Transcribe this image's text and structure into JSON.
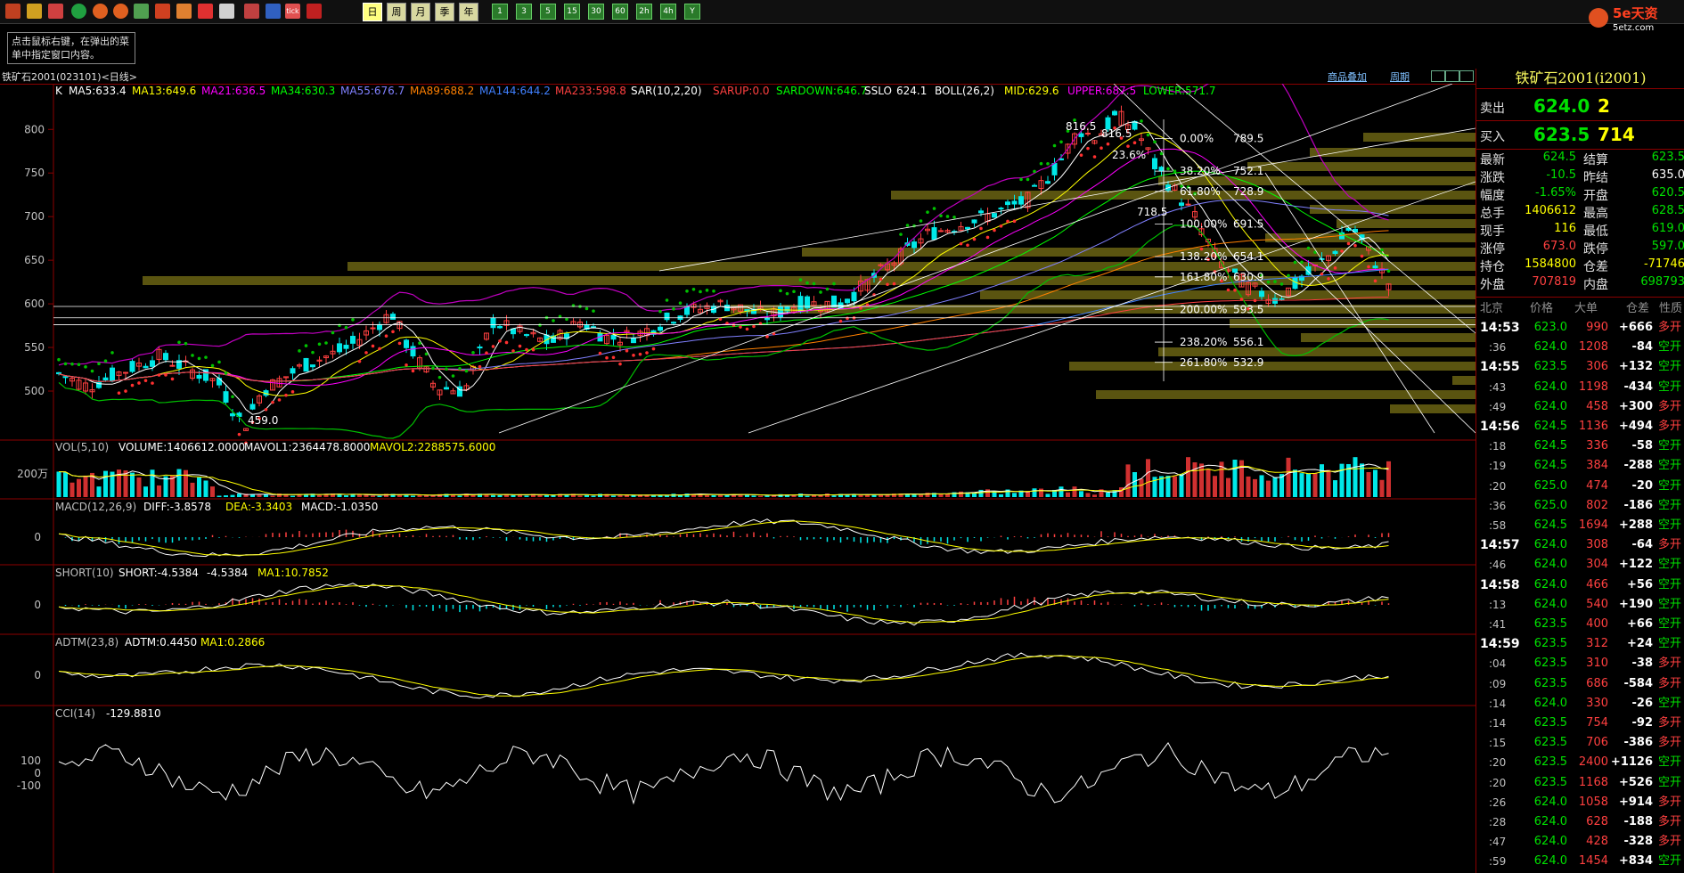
{
  "toolbar": {
    "icons": [
      "home-icon",
      "folder-icon",
      "window-icon",
      "refresh-icon",
      "zoom-in-icon",
      "zoom-out-icon",
      "tile-icon",
      "pen-icon",
      "brush-icon",
      "filter-icon",
      "new-icon",
      "table-icon",
      "tick-icon",
      "cross-icon"
    ],
    "tick_label": "tick",
    "periods": [
      "日",
      "周",
      "月",
      "季",
      "年"
    ],
    "active_period": "日",
    "intervals": [
      "1",
      "3",
      "5",
      "15",
      "30",
      "60",
      "2h",
      "4h",
      "Y"
    ]
  },
  "brand": {
    "name": "5e天资",
    "site": "5etz.com"
  },
  "tip": "点击鼠标右键，在弹出的菜单中指定窗口内容。",
  "window_title": "铁矿石2001(023101)<日线>",
  "title_links": [
    "商品叠加",
    "周期"
  ],
  "legend": {
    "main": [
      {
        "t": "K",
        "c": "#ffffff"
      },
      {
        "t": "MA5:633.4",
        "c": "#ffffff"
      },
      {
        "t": "MA13:649.6",
        "c": "#ffff00"
      },
      {
        "t": "MA21:636.5",
        "c": "#ff00ff"
      },
      {
        "t": "MA34:630.3",
        "c": "#00ff00"
      },
      {
        "t": "MA55:676.7",
        "c": "#8080ff"
      },
      {
        "t": "MA89:688.2",
        "c": "#ff8000"
      },
      {
        "t": "MA144:644.2",
        "c": "#4080ff"
      },
      {
        "t": "MA233:598.8",
        "c": "#ff4040"
      },
      {
        "t": "SAR(10,2,20)",
        "c": "#ffffff"
      },
      {
        "t": "SARUP:0.0",
        "c": "#ff4040"
      },
      {
        "t": "SARDOWN:646.7",
        "c": "#00ff00"
      },
      {
        "t": "SSLO",
        "c": "#ffffff"
      },
      {
        "t": "624.1",
        "c": "#ffffff"
      },
      {
        "t": "BOLL(26,2)",
        "c": "#ffffff"
      },
      {
        "t": "MID:629.6",
        "c": "#ffff00"
      },
      {
        "t": "UPPER:687.5",
        "c": "#ff00ff"
      },
      {
        "t": "LOWER:571.7",
        "c": "#00ff00"
      }
    ],
    "vol": [
      {
        "t": "VOL(5,10)",
        "c": "#c0c0c0"
      },
      {
        "t": "VOLUME:1406612.0000",
        "c": "#ffffff"
      },
      {
        "t": "MAVOL1:2364478.8000",
        "c": "#ffffff"
      },
      {
        "t": "MAVOL2:2288575.6000",
        "c": "#ffff00"
      }
    ],
    "macd": [
      {
        "t": "MACD(12,26,9)",
        "c": "#c0c0c0"
      },
      {
        "t": "DIFF:-3.8578",
        "c": "#ffffff"
      },
      {
        "t": "DEA:-3.3403",
        "c": "#ffff00"
      },
      {
        "t": "MACD:-1.0350",
        "c": "#ffffff"
      }
    ],
    "short": [
      {
        "t": "SHORT(10)",
        "c": "#c0c0c0"
      },
      {
        "t": "SHORT:-4.5384",
        "c": "#ffffff"
      },
      {
        "t": "-4.5384",
        "c": "#ffffff"
      },
      {
        "t": "MA1:10.7852",
        "c": "#ffff00"
      }
    ],
    "adtm": [
      {
        "t": "ADTM(23,8)",
        "c": "#c0c0c0"
      },
      {
        "t": "ADTM:0.4450",
        "c": "#ffffff"
      },
      {
        "t": "MA1:0.2866",
        "c": "#ffff00"
      }
    ],
    "cci": [
      {
        "t": "CCI(14)",
        "c": "#c0c0c0"
      },
      {
        "t": "-129.8810",
        "c": "#ffffff"
      }
    ]
  },
  "chart_data": {
    "type": "candlestick",
    "price_axis": {
      "ticks": [
        800,
        750,
        700,
        650,
        600,
        550,
        500
      ],
      "range": [
        452,
        836
      ]
    },
    "vol_axis_label": "200万",
    "macd_axis_label": "0",
    "short_axis_label": "0",
    "adtm_axis_label": "0",
    "cci_axis_labels": [
      "100",
      "0",
      "-100"
    ],
    "annotations": {
      "high": "816.5",
      "low": "459.0",
      "high2": "816.5",
      "low2": "718.5"
    },
    "fib_levels": [
      {
        "pct": "0.00%",
        "val": "789.5"
      },
      {
        "pct": "38.20%",
        "val": "752.1"
      },
      {
        "pct": "61.80%",
        "val": "728.9"
      },
      {
        "pct": "100.00%",
        "val": "691.5"
      },
      {
        "pct": "138.20%",
        "val": "654.1"
      },
      {
        "pct": "161.80%",
        "val": "630.9"
      },
      {
        "pct": "200.00%",
        "val": "593.5"
      },
      {
        "pct": "238.20%",
        "val": "556.1"
      },
      {
        "pct": "261.80%",
        "val": "532.9"
      }
    ],
    "fib_partial": [
      "23.6%",
      "0.00%"
    ],
    "last_close": 624.5
  },
  "quote": {
    "symbol_title": "铁矿石2001(i2001)",
    "sell": {
      "label": "卖出",
      "price": "624.0",
      "qty": "2"
    },
    "buy": {
      "label": "买入",
      "price": "623.5",
      "qty": "714"
    },
    "rows": [
      [
        {
          "l": "最新",
          "v": "624.5",
          "c": "dn"
        },
        {
          "l": "结算",
          "v": "623.5",
          "c": "dn"
        }
      ],
      [
        {
          "l": "涨跌",
          "v": "-10.5",
          "c": "dn"
        },
        {
          "l": "昨结",
          "v": "635.0",
          "c": "wt"
        }
      ],
      [
        {
          "l": "幅度",
          "v": "-1.65%",
          "c": "dn"
        },
        {
          "l": "开盘",
          "v": "620.5",
          "c": "dn"
        }
      ],
      [
        {
          "l": "总手",
          "v": "1406612",
          "c": "yl"
        },
        {
          "l": "最高",
          "v": "628.5",
          "c": "dn"
        }
      ],
      [
        {
          "l": "现手",
          "v": "116",
          "c": "yl"
        },
        {
          "l": "最低",
          "v": "619.0",
          "c": "dn"
        }
      ],
      [
        {
          "l": "涨停",
          "v": "673.0",
          "c": "up"
        },
        {
          "l": "跌停",
          "v": "597.0",
          "c": "dn"
        }
      ],
      [
        {
          "l": "持仓",
          "v": "1584800",
          "c": "yl"
        },
        {
          "l": "仓差",
          "v": "-71746",
          "c": "yl"
        }
      ],
      [
        {
          "l": "外盘",
          "v": "707819",
          "c": "up"
        },
        {
          "l": "内盘",
          "v": "698793",
          "c": "dn"
        }
      ]
    ],
    "tick_header": [
      "北京",
      "价格",
      "大单",
      "仓差",
      "性质"
    ],
    "ticks": [
      {
        "t": "14:53",
        "b": true,
        "p": "623.0",
        "q": "990",
        "d": "+666",
        "n": "多开"
      },
      {
        "t": ":36",
        "b": false,
        "p": "624.0",
        "q": "1208",
        "d": "-84",
        "n": "空开"
      },
      {
        "t": "14:55",
        "b": true,
        "p": "623.5",
        "q": "306",
        "d": "+132",
        "n": "空开"
      },
      {
        "t": ":43",
        "b": false,
        "p": "624.0",
        "q": "1198",
        "d": "-434",
        "n": "空开"
      },
      {
        "t": ":49",
        "b": false,
        "p": "624.0",
        "q": "458",
        "d": "+300",
        "n": "多开"
      },
      {
        "t": "14:56",
        "b": true,
        "p": "624.5",
        "q": "1136",
        "d": "+494",
        "n": "多开"
      },
      {
        "t": ":18",
        "b": false,
        "p": "624.5",
        "q": "336",
        "d": "-58",
        "n": "空开"
      },
      {
        "t": ":19",
        "b": false,
        "p": "624.5",
        "q": "384",
        "d": "-288",
        "n": "空开"
      },
      {
        "t": ":20",
        "b": false,
        "p": "625.0",
        "q": "474",
        "d": "-20",
        "n": "空开"
      },
      {
        "t": ":36",
        "b": false,
        "p": "625.0",
        "q": "802",
        "d": "-186",
        "n": "空开"
      },
      {
        "t": ":58",
        "b": false,
        "p": "624.5",
        "q": "1694",
        "d": "+288",
        "n": "空开"
      },
      {
        "t": "14:57",
        "b": true,
        "p": "624.0",
        "q": "308",
        "d": "-64",
        "n": "多开"
      },
      {
        "t": ":46",
        "b": false,
        "p": "624.0",
        "q": "304",
        "d": "+122",
        "n": "空开"
      },
      {
        "t": "14:58",
        "b": true,
        "p": "624.0",
        "q": "466",
        "d": "+56",
        "n": "空开"
      },
      {
        "t": ":13",
        "b": false,
        "p": "624.0",
        "q": "540",
        "d": "+190",
        "n": "空开"
      },
      {
        "t": ":41",
        "b": false,
        "p": "623.5",
        "q": "400",
        "d": "+66",
        "n": "空开"
      },
      {
        "t": "14:59",
        "b": true,
        "p": "623.5",
        "q": "312",
        "d": "+24",
        "n": "空开"
      },
      {
        "t": ":04",
        "b": false,
        "p": "623.5",
        "q": "310",
        "d": "-38",
        "n": "多开"
      },
      {
        "t": ":09",
        "b": false,
        "p": "623.5",
        "q": "686",
        "d": "-584",
        "n": "多开"
      },
      {
        "t": ":14",
        "b": false,
        "p": "624.0",
        "q": "330",
        "d": "-26",
        "n": "空开"
      },
      {
        "t": ":14",
        "b": false,
        "p": "623.5",
        "q": "754",
        "d": "-92",
        "n": "多开"
      },
      {
        "t": ":15",
        "b": false,
        "p": "623.5",
        "q": "706",
        "d": "-386",
        "n": "多开"
      },
      {
        "t": ":20",
        "b": false,
        "p": "623.5",
        "q": "2400",
        "d": "+1126",
        "n": "空开"
      },
      {
        "t": ":20",
        "b": false,
        "p": "623.5",
        "q": "1168",
        "d": "+526",
        "n": "空开"
      },
      {
        "t": ":26",
        "b": false,
        "p": "624.0",
        "q": "1058",
        "d": "+914",
        "n": "多开"
      },
      {
        "t": ":28",
        "b": false,
        "p": "624.0",
        "q": "628",
        "d": "-188",
        "n": "多开"
      },
      {
        "t": ":47",
        "b": false,
        "p": "624.0",
        "q": "428",
        "d": "-328",
        "n": "多开"
      },
      {
        "t": ":59",
        "b": false,
        "p": "624.0",
        "q": "1454",
        "d": "+834",
        "n": "空开"
      }
    ]
  }
}
